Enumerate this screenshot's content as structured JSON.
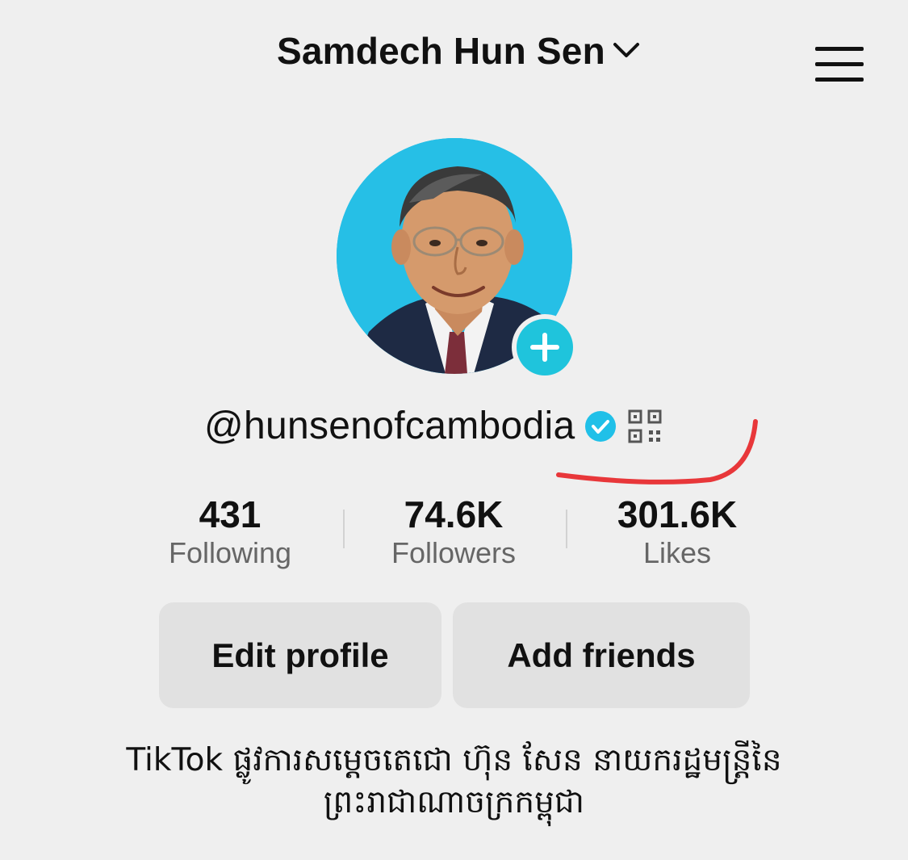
{
  "header": {
    "account_name": "Samdech Hun Sen",
    "chevron_icon": "chevron-down-icon",
    "menu_icon": "hamburger-menu-icon"
  },
  "profile": {
    "avatar_alt": "profile-photo",
    "add_icon": "plus-icon",
    "handle": "@hunsenofcambodia",
    "verified_icon": "verified-check-icon",
    "qr_icon": "qr-code-icon"
  },
  "stats": [
    {
      "value": "431",
      "label": "Following"
    },
    {
      "value": "74.6K",
      "label": "Followers"
    },
    {
      "value": "301.6K",
      "label": "Likes"
    }
  ],
  "buttons": {
    "edit_profile": "Edit profile",
    "add_friends": "Add friends"
  },
  "bio": {
    "line1": "TikTok ផ្លូវការសម្ដេចតេជោ ហ៊ុន សែន នាយករដ្ឋមន្ត្រីនៃ",
    "line2": "ព្រះរាជាណាចក្រកម្ពុជា"
  },
  "colors": {
    "background": "#efefef",
    "accent": "#1fc4dc",
    "button_bg": "#e1e1e1",
    "annotation": "#e8373a"
  }
}
